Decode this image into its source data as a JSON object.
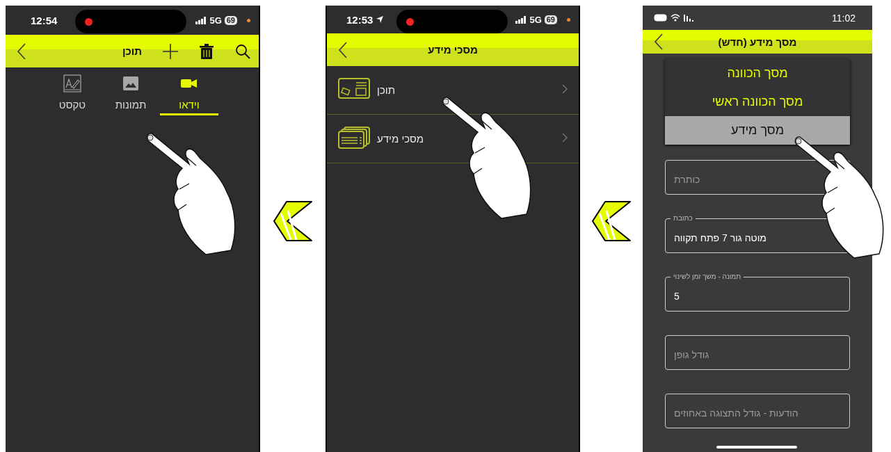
{
  "screens": [
    {
      "kind": "form",
      "status": {
        "time": "11:02"
      },
      "header": {
        "title": "מסך מידע (חדש)"
      },
      "options": [
        {
          "label": "מסך הכוונה",
          "selected": false
        },
        {
          "label": "מסך הכוונה ראשי",
          "selected": false
        },
        {
          "label": "מסך מידע",
          "selected": true
        }
      ],
      "fields": [
        {
          "placeholder": "כותרת"
        },
        {
          "label": "כתובת",
          "value": "מוטה גור 7 פתח תקווה"
        },
        {
          "label": "תמונה - משך זמן לשינוי",
          "value": "5"
        },
        {
          "placeholder": "גודל גופן"
        },
        {
          "placeholder": "הודעות - גודל התצוגה באחוזים"
        }
      ]
    },
    {
      "kind": "menu",
      "status": {
        "time": "12:53",
        "network": "5G",
        "battery": "69",
        "location": true
      },
      "header": {
        "title": "מסכי מידע"
      },
      "items": [
        {
          "label": "תוכן"
        },
        {
          "label": "מסכי מידע"
        }
      ]
    },
    {
      "kind": "tabs",
      "status": {
        "time": "12:54",
        "network": "5G",
        "battery": "69"
      },
      "header": {
        "title": "תוכן"
      },
      "tabs": [
        {
          "label": "וידאו",
          "selected": true
        },
        {
          "label": "תמונות",
          "selected": false
        },
        {
          "label": "טקסט",
          "selected": false
        }
      ]
    }
  ]
}
